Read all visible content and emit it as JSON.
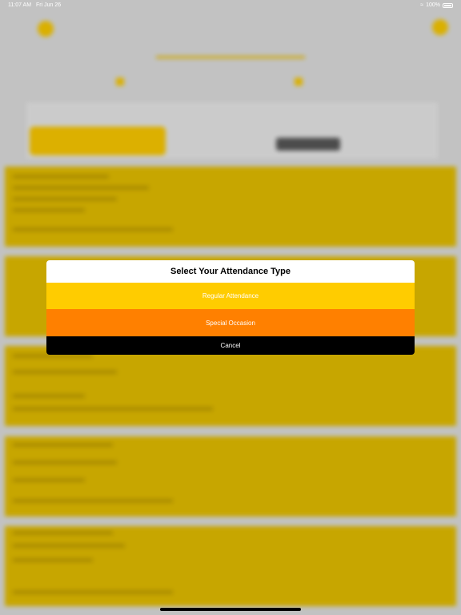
{
  "status_bar": {
    "time": "11:07 AM",
    "date": "Fri Jun 26",
    "battery": "100%"
  },
  "dialog": {
    "title": "Select Your Attendance Type",
    "options": [
      {
        "label": "Regular Attendance",
        "color": "#ffcc00"
      },
      {
        "label": "Special Occasion",
        "color": "#ff8000"
      }
    ],
    "cancel_label": "Cancel"
  },
  "colors": {
    "accent_yellow": "#ffcc00",
    "accent_orange": "#ff8000"
  }
}
